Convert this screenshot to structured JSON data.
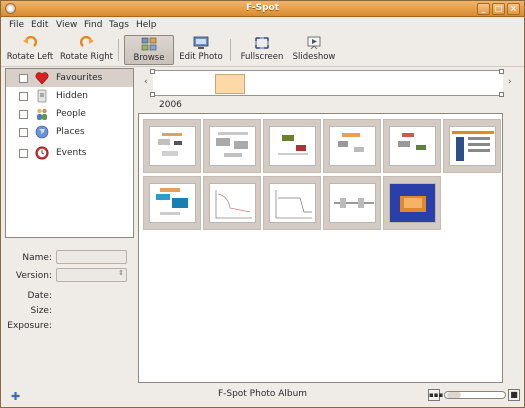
{
  "window": {
    "title": "F-Spot",
    "buttons": [
      "_",
      "□",
      "×"
    ]
  },
  "menu": [
    "File",
    "Edit",
    "View",
    "Find",
    "Tags",
    "Help"
  ],
  "toolbar": {
    "items": [
      {
        "label": "Rotate Left",
        "icon": "rotate-left-icon"
      },
      {
        "label": "Rotate Right",
        "icon": "rotate-right-icon"
      },
      {
        "label": "Browse",
        "icon": "browse-icon"
      },
      {
        "label": "Edit Photo",
        "icon": "edit-photo-icon"
      },
      {
        "label": "Fullscreen",
        "icon": "fullscreen-icon"
      },
      {
        "label": "Slideshow",
        "icon": "slideshow-icon"
      }
    ],
    "active": "Browse"
  },
  "tags": [
    {
      "label": "Favourites",
      "icon": "heart-icon",
      "color": "#d92020",
      "selected": true
    },
    {
      "label": "Hidden",
      "icon": "hidden-icon",
      "color": "#9a9a9a",
      "selected": false
    },
    {
      "label": "People",
      "icon": "people-icon",
      "color": "#4d7bc4",
      "selected": false
    },
    {
      "label": "Places",
      "icon": "places-icon",
      "color": "#4f7bd0",
      "selected": false
    },
    {
      "label": "Events",
      "icon": "events-icon",
      "color": "#d22b2b",
      "selected": false
    }
  ],
  "info": {
    "name_label": "Name:",
    "version_label": "Version:",
    "date_label": "Date:",
    "size_label": "Size:",
    "exposure_label": "Exposure:"
  },
  "timeline": {
    "year_label": "2006"
  },
  "status": {
    "text": "F-Spot Photo Album"
  },
  "photos_count": 11,
  "colors": {
    "titlebar": "#e39b45",
    "accent": "#fdd9a8",
    "thumb_bg": "#d4ccc4"
  }
}
